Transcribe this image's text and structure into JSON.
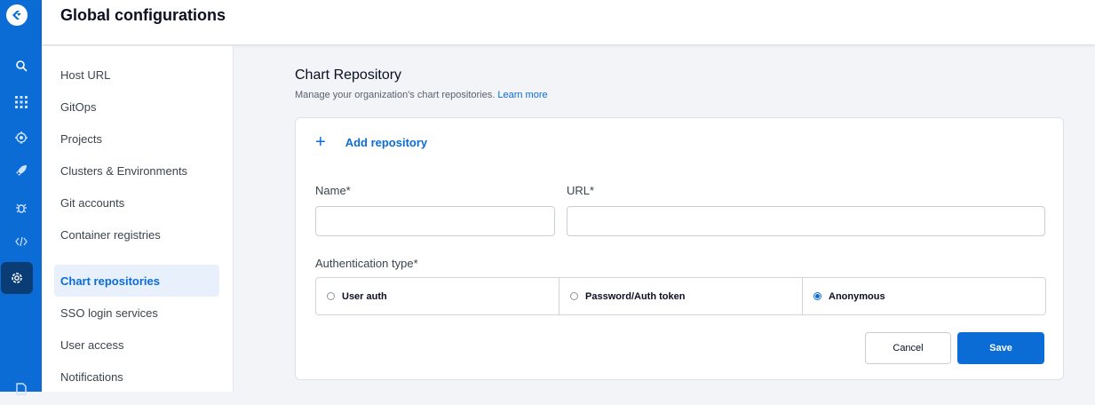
{
  "header": {
    "title": "Global configurations"
  },
  "rail": {
    "icons": [
      "logo-icon",
      "search-icon",
      "apps-grid-icon",
      "bug-gear-icon",
      "rocket-icon",
      "bug-icon",
      "code-icon",
      "gear-icon"
    ]
  },
  "sidebar": {
    "items": [
      {
        "label": "Host URL"
      },
      {
        "label": "GitOps"
      },
      {
        "label": "Projects"
      },
      {
        "label": "Clusters & Environments"
      },
      {
        "label": "Git accounts"
      },
      {
        "label": "Container registries"
      },
      {
        "label": "Chart repositories",
        "active": true
      },
      {
        "label": "SSO login services"
      },
      {
        "label": "User access"
      },
      {
        "label": "Notifications"
      }
    ]
  },
  "main": {
    "title": "Chart Repository",
    "subtitle": "Manage your organization's chart repositories.",
    "learn_more": "Learn more",
    "add_repository": "Add repository",
    "name_label": "Name*",
    "url_label": "URL*",
    "name_value": "",
    "url_value": "",
    "auth_label": "Authentication type*",
    "auth_options": [
      {
        "label": "User auth",
        "selected": false
      },
      {
        "label": "Password/Auth token",
        "selected": false
      },
      {
        "label": "Anonymous",
        "selected": true
      }
    ],
    "cancel_label": "Cancel",
    "save_label": "Save"
  },
  "colors": {
    "accent": "#0b6cd6",
    "rail": "#0b6cd6",
    "rail_active": "#0a3c75"
  }
}
